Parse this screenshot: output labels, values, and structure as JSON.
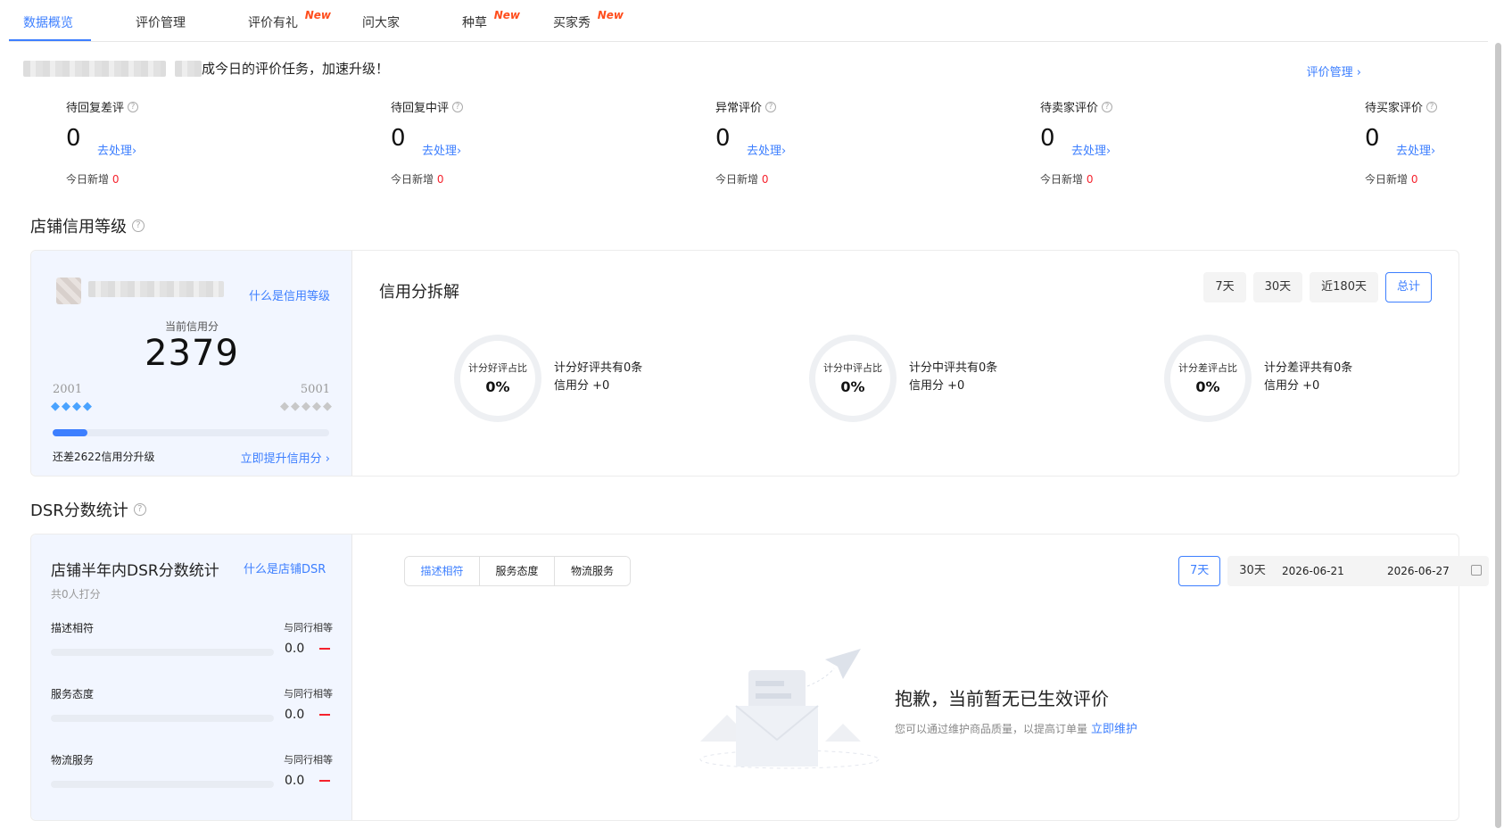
{
  "tabs": [
    {
      "label": "数据概览",
      "new": ""
    },
    {
      "label": "评价管理",
      "new": ""
    },
    {
      "label": "评价有礼",
      "new": "New"
    },
    {
      "label": "问大家",
      "new": ""
    },
    {
      "label": "种草",
      "new": "New"
    },
    {
      "label": "买家秀",
      "new": "New"
    }
  ],
  "notice": {
    "text": "成今日的评价任务，加速升级！",
    "link": "评价管理 ›"
  },
  "stats": [
    {
      "label": "待回复差评",
      "value": "0",
      "action": "去处理›",
      "today_label": "今日新增",
      "today_value": "0"
    },
    {
      "label": "待回复中评",
      "value": "0",
      "action": "去处理›",
      "today_label": "今日新增",
      "today_value": "0"
    },
    {
      "label": "异常评价",
      "value": "0",
      "action": "去处理›",
      "today_label": "今日新增",
      "today_value": "0"
    },
    {
      "label": "待卖家评价",
      "value": "0",
      "action": "去处理›",
      "today_label": "今日新增",
      "today_value": "0"
    },
    {
      "label": "待买家评价",
      "value": "0",
      "action": "去处理›",
      "today_label": "今日新增",
      "today_value": "0"
    }
  ],
  "credit": {
    "section_title": "店铺信用等级",
    "what_link": "什么是信用等级",
    "current_label": "当前信用分",
    "current_score": "2379",
    "level_min": "2001",
    "level_max": "5001",
    "progress": 0.127,
    "gap_text": "还差2622信用分升级",
    "upgrade_link": "立即提升信用分 ›",
    "breakdown_title": "信用分拆解",
    "ranges": [
      "7天",
      "30天",
      "近180天",
      "总计"
    ],
    "active_range": "总计",
    "rings": [
      {
        "label": "计分好评占比",
        "percent": "0%",
        "desc1": "计分好评共有0条",
        "desc2": "信用分 +0"
      },
      {
        "label": "计分中评占比",
        "percent": "0%",
        "desc1": "计分中评共有0条",
        "desc2": "信用分 +0"
      },
      {
        "label": "计分差评占比",
        "percent": "0%",
        "desc1": "计分差评共有0条",
        "desc2": "信用分 +0"
      }
    ]
  },
  "dsr": {
    "section_title": "DSR分数统计",
    "panel_title": "店铺半年内DSR分数统计",
    "what_link": "什么是店铺DSR",
    "count": "共0人打分",
    "rows": [
      {
        "name": "描述相符",
        "compare": "与同行相等",
        "score": "0.0"
      },
      {
        "name": "服务态度",
        "compare": "与同行相等",
        "score": "0.0"
      },
      {
        "name": "物流服务",
        "compare": "与同行相等",
        "score": "0.0"
      }
    ],
    "segments": [
      "描述相符",
      "服务态度",
      "物流服务"
    ],
    "active_segment": "描述相符",
    "ranges": [
      "7天",
      "30天"
    ],
    "active_range": "7天",
    "date_start": "2026-06-21",
    "date_end": "2026-06-27",
    "empty_title": "抱歉，当前暂无已生效评价",
    "empty_sub": "您可以通过维护商品质量，以提高订单量",
    "empty_link": "立即维护"
  },
  "colors": {
    "accent": "#3d7fff",
    "new_tag": "#ff4d1c",
    "red": "#f5222d",
    "panel_bg": "#f2f6ff"
  }
}
